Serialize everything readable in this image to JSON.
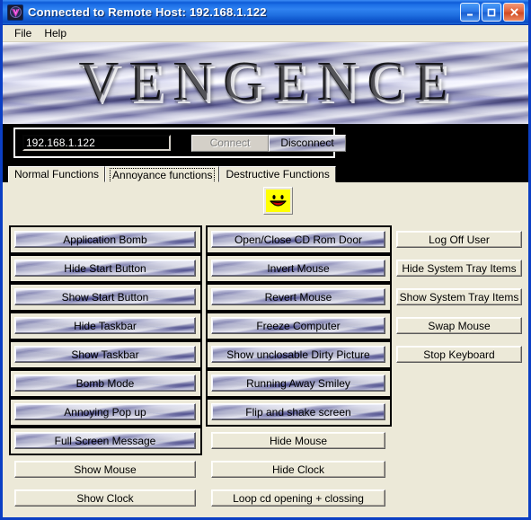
{
  "window": {
    "title": "Connected to Remote Host: 192.168.1.122",
    "icon": "vengence-app-icon",
    "minimize_label": "Minimize",
    "maximize_label": "Maximize",
    "close_label": "Close"
  },
  "menu": {
    "items": [
      {
        "label": "File"
      },
      {
        "label": "Help"
      }
    ]
  },
  "banner": {
    "title": "VENGENCE"
  },
  "connection": {
    "ip_value": "192.168.1.122",
    "ip_placeholder": "",
    "connect_label": "Connect",
    "connect_enabled": false,
    "disconnect_label": "Disconnect",
    "disconnect_enabled": true
  },
  "tabs": [
    {
      "label": "Normal Functions",
      "active": false
    },
    {
      "label": "Annoyance functions",
      "active": true
    },
    {
      "label": "Destructive Functions",
      "active": false
    }
  ],
  "panel": {
    "smiley_icon": "smiley-face-icon",
    "col_left": [
      {
        "label": "Application Bomb",
        "style": "chrome",
        "framed": true
      },
      {
        "label": "Hide Start Button",
        "style": "chrome",
        "framed": true
      },
      {
        "label": "Show Start Button",
        "style": "chrome",
        "framed": true
      },
      {
        "label": "Hide Taskbar",
        "style": "chrome",
        "framed": true
      },
      {
        "label": "Show Taskbar",
        "style": "chrome",
        "framed": true
      },
      {
        "label": "Bomb Mode",
        "style": "chrome",
        "framed": true
      },
      {
        "label": "Annoying Pop up",
        "style": "chrome",
        "framed": true
      },
      {
        "label": "Full Screen Message",
        "style": "chrome",
        "framed": true
      },
      {
        "label": "Show Mouse",
        "style": "plain",
        "framed": false
      },
      {
        "label": "Show Clock",
        "style": "plain",
        "framed": false
      }
    ],
    "col_mid": [
      {
        "label": "Open/Close CD Rom Door",
        "style": "chrome",
        "framed": true
      },
      {
        "label": "Invert Mouse",
        "style": "chrome",
        "framed": true
      },
      {
        "label": "Revert Mouse",
        "style": "chrome",
        "framed": true
      },
      {
        "label": "Freeze Computer",
        "style": "chrome",
        "framed": true
      },
      {
        "label": "Show unclosable Dirty Picture",
        "style": "chrome",
        "framed": true
      },
      {
        "label": "Running Away Smiley",
        "style": "chrome",
        "framed": true
      },
      {
        "label": "Flip and shake screen",
        "style": "chrome",
        "framed": true
      },
      {
        "label": "Hide Mouse",
        "style": "plain",
        "framed": false
      },
      {
        "label": "Hide Clock",
        "style": "plain",
        "framed": false
      },
      {
        "label": "Loop cd opening + clossing",
        "style": "plain",
        "framed": false
      }
    ],
    "col_right": [
      {
        "label": "Log Off User",
        "style": "plain",
        "framed": false
      },
      {
        "label": "Hide System Tray Items",
        "style": "plain",
        "framed": false
      },
      {
        "label": "Show System Tray Items",
        "style": "plain",
        "framed": false
      },
      {
        "label": "Swap Mouse",
        "style": "plain",
        "framed": false
      },
      {
        "label": "Stop Keyboard",
        "style": "plain",
        "framed": false
      }
    ]
  },
  "colors": {
    "titlebar_blue": "#0c59d6",
    "window_border": "#0b3fc4",
    "face_beige": "#ece9d8",
    "chrome_gray": "#9496ae",
    "smiley_yellow": "#ffff00",
    "close_red": "#d04a22",
    "black_bg": "#000000"
  }
}
